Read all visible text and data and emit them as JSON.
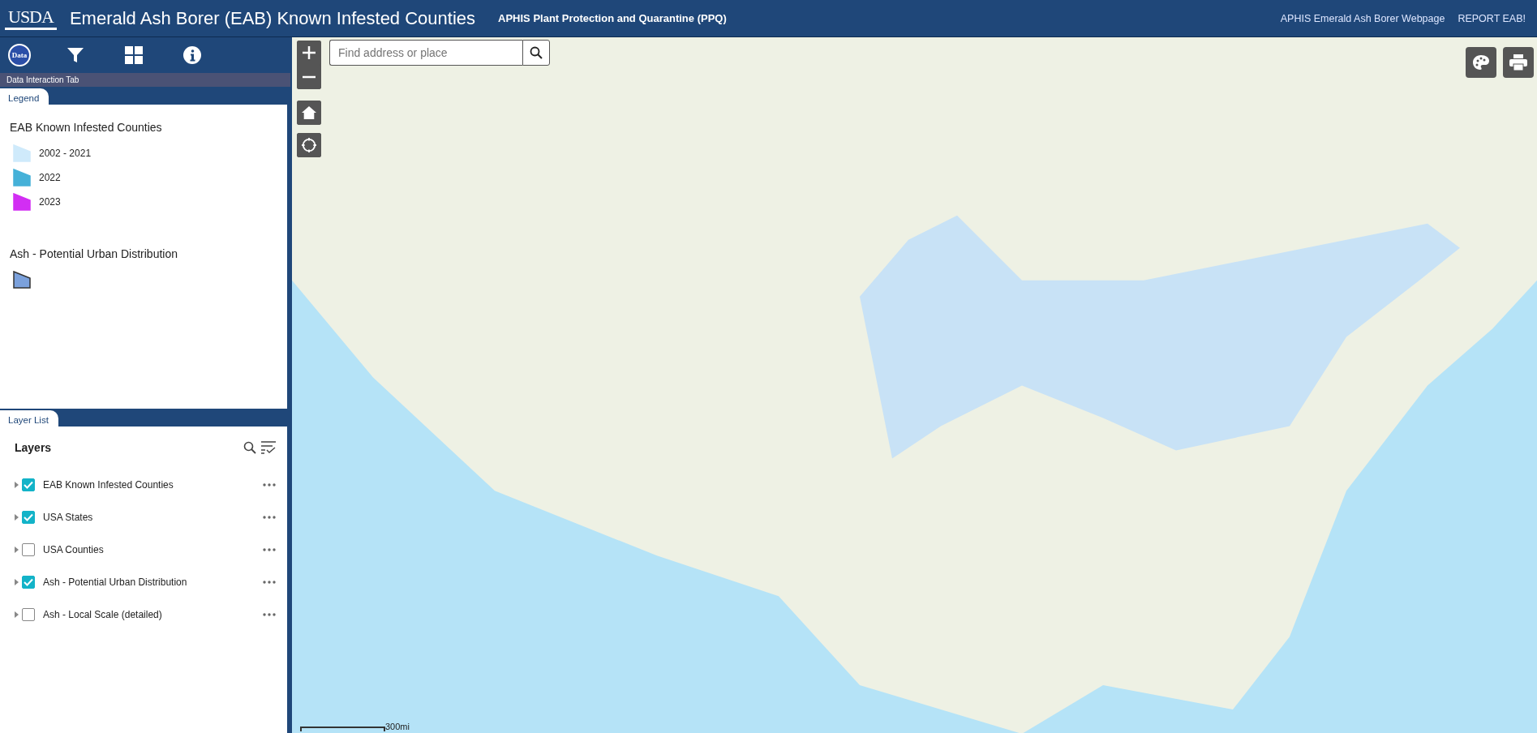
{
  "header": {
    "logo": "USDA",
    "title": "Emerald Ash Borer (EAB) Known Infested Counties",
    "subtitle": "APHIS Plant Protection and Quarantine (PPQ)",
    "links": [
      "APHIS Emerald Ash Borer Webpage",
      "REPORT EAB!"
    ]
  },
  "toolbar": {
    "items": [
      {
        "kind": "data",
        "label": "Data"
      },
      {
        "kind": "filter"
      },
      {
        "kind": "grid"
      },
      {
        "kind": "info"
      }
    ],
    "caption": "Data Interaction Tab"
  },
  "legend": {
    "tab": "Legend",
    "groups": [
      {
        "title": "EAB Known Infested Counties",
        "items": [
          {
            "label": "2002 - 2021",
            "color": "#cfeafb"
          },
          {
            "label": "2022",
            "color": "#45b1d8"
          },
          {
            "label": "2023",
            "color": "#d22ef3"
          }
        ]
      },
      {
        "title": "Ash - Potential Urban Distribution",
        "items": [
          {
            "color": "#7ba1dc"
          }
        ]
      }
    ]
  },
  "layer_list": {
    "tab": "Layer List",
    "title": "Layers",
    "layers": [
      {
        "name": "EAB Known Infested Counties",
        "checked": true
      },
      {
        "name": "USA States",
        "checked": true
      },
      {
        "name": "USA Counties",
        "checked": false
      },
      {
        "name": "Ash - Potential Urban Distribution",
        "checked": true
      },
      {
        "name": "Ash - Local Scale (detailed)",
        "checked": false
      }
    ]
  },
  "map": {
    "search": {
      "placeholder": "Find address or place"
    },
    "scale": "300mi"
  }
}
